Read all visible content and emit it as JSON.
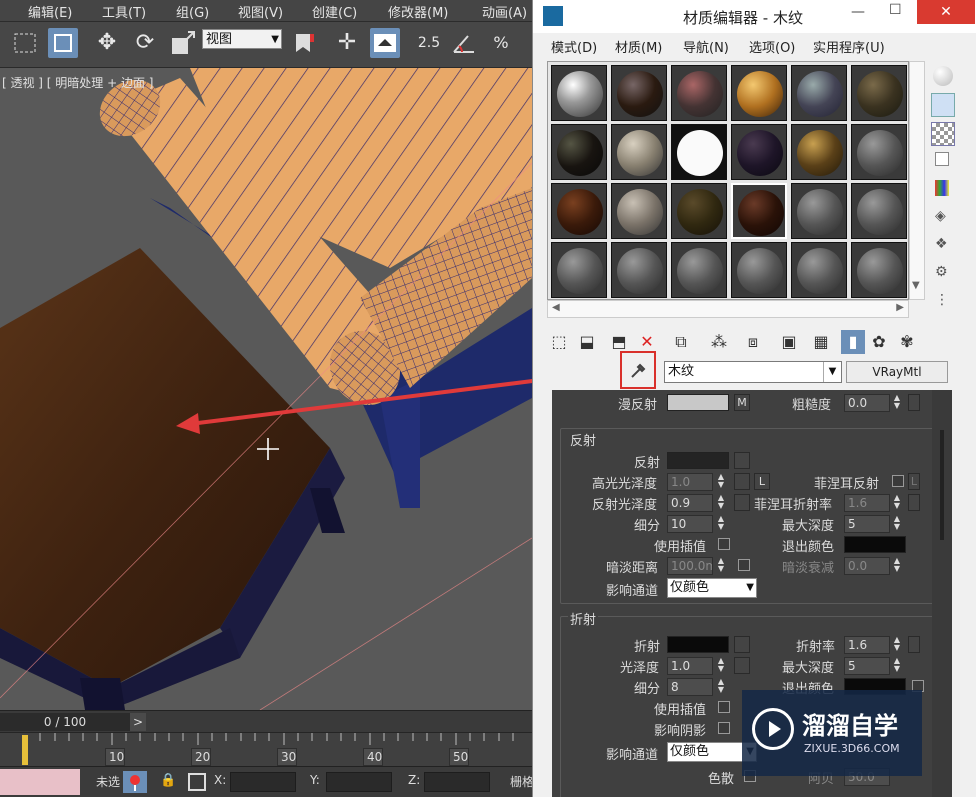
{
  "main_menu": [
    "编辑(E)",
    "工具(T)",
    "组(G)",
    "视图(V)",
    "创建(C)",
    "修改器(M)",
    "动画(A)"
  ],
  "toolbar": {
    "view_select": "视图",
    "snap_angle": "2.5",
    "percent": "%"
  },
  "viewport": {
    "label": "[ 透视 ] [ 明暗处理 + 边面 ]"
  },
  "timeline": {
    "frame": "0 / 100",
    "next": ">",
    "ruler_ticks": [
      "10",
      "20",
      "30",
      "40",
      "50"
    ]
  },
  "status": {
    "prefix": "未选",
    "x_label": "X:",
    "y_label": "Y:",
    "z_label": "Z:",
    "grid_label": "栅格"
  },
  "mat_editor": {
    "title": "材质编辑器 - 木纹",
    "menu": [
      "模式(D)",
      "材质(M)",
      "导航(N)",
      "选项(O)",
      "实用程序(U)"
    ],
    "material_name": "木纹",
    "material_type": "VRayMtl",
    "top_row": {
      "diffuse": "漫反射",
      "m": "M",
      "roughness": "粗糙度",
      "roughness_val": "0.0"
    },
    "reflection": {
      "title": "反射",
      "reflect": "反射",
      "hilight_gloss": "高光光泽度",
      "hilight_gloss_val": "1.0",
      "l": "L",
      "fresnel": "菲涅耳反射",
      "refl_gloss": "反射光泽度",
      "refl_gloss_val": "0.9",
      "fresnel_ior": "菲涅耳折射率",
      "fresnel_ior_val": "1.6",
      "subdivs": "细分",
      "subdivs_val": "10",
      "max_depth": "最大深度",
      "max_depth_val": "5",
      "use_interp": "使用插值",
      "exit_color": "退出颜色",
      "dim_dist": "暗淡距离",
      "dim_dist_val": "100.0m",
      "dim_falloff": "暗淡衰减",
      "dim_falloff_val": "0.0",
      "affect_channels": "影响通道",
      "affect_channels_val": "仅颜色"
    },
    "refraction": {
      "title": "折射",
      "refract": "折射",
      "ior": "折射率",
      "ior_val": "1.6",
      "gloss": "光泽度",
      "gloss_val": "1.0",
      "max_depth": "最大深度",
      "max_depth_val": "5",
      "subdivs": "细分",
      "subdivs_val": "8",
      "exit_color": "退出颜色",
      "use_interp": "使用插值",
      "affect_shadows": "影响阴影",
      "affect_channels": "影响通道",
      "affect_channels_val": "仅颜色",
      "dispersion": "色散",
      "abbe": "阿贝",
      "abbe_val": "50.0"
    }
  },
  "watermark": {
    "name": "溜溜自学",
    "url": "ZIXUE.3D66.COM"
  },
  "colors": {
    "accent_blue": "#6b8fb8",
    "highlight_red": "#d9302b",
    "arrow_red": "#e03a3a"
  }
}
